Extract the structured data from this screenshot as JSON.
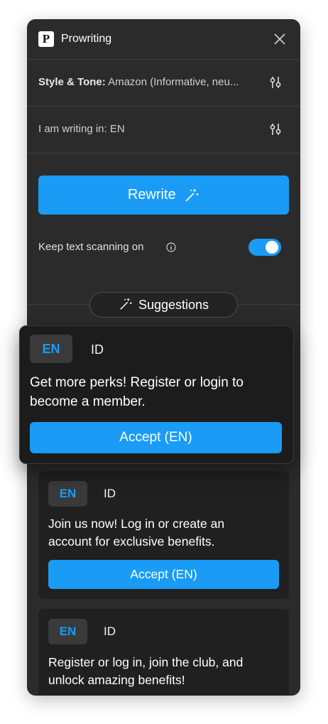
{
  "app": {
    "title": "Prowriting",
    "logo_letter": "P"
  },
  "settings": {
    "style_label": "Style & Tone:",
    "style_value": "Amazon (Informative, neu...",
    "language_label": "I am writing in:",
    "language_value": "EN"
  },
  "rewrite": {
    "label": "Rewrite"
  },
  "scan": {
    "label": "Keep text scanning on",
    "enabled": true
  },
  "suggestions": {
    "label": "Suggestions",
    "cards": [
      {
        "lang_primary": "EN",
        "lang_secondary": "ID",
        "text": "Get more perks! Register or login to become a member.",
        "accept": "Accept (EN)"
      },
      {
        "lang_primary": "EN",
        "lang_secondary": "ID",
        "text": "Join us now! Log in or create an account for exclusive benefits.",
        "accept": "Accept (EN)"
      },
      {
        "lang_primary": "EN",
        "lang_secondary": "ID",
        "text": "Register or log in, join the club, and unlock amazing benefits!"
      }
    ]
  },
  "colors": {
    "accent": "#1a9bf5",
    "panel": "#2b2b2b",
    "card": "#202020"
  }
}
